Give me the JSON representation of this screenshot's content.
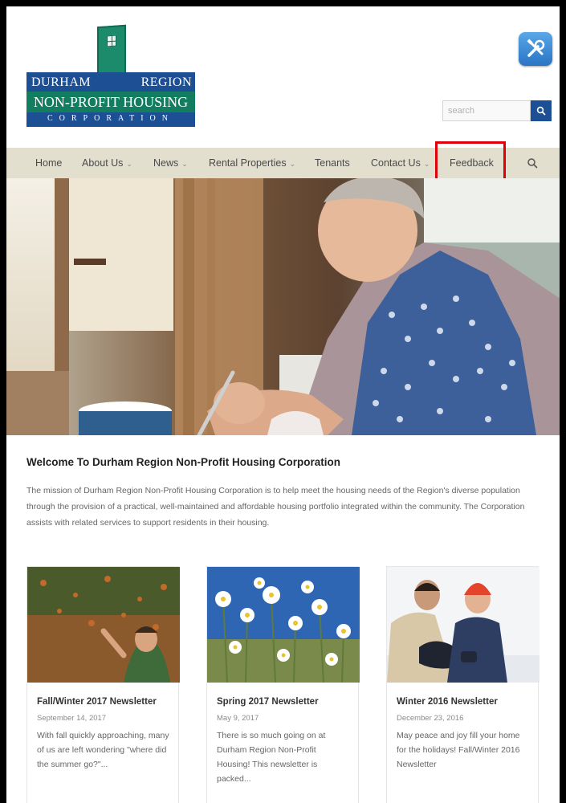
{
  "logo": {
    "word_left": "DURHAM",
    "word_right": "REGION",
    "word_mid": "NON-PROFIT HOUSING",
    "word_corp": "CORPORATION"
  },
  "header": {
    "tools_icon": "tools-icon",
    "search_placeholder": "search",
    "search_button_icon": "search-icon"
  },
  "nav": {
    "items": [
      {
        "label": "Home",
        "has_dropdown": false
      },
      {
        "label": "About Us",
        "has_dropdown": true
      },
      {
        "label": "News",
        "has_dropdown": true
      },
      {
        "label": "Rental Properties",
        "has_dropdown": true
      },
      {
        "label": "Tenants",
        "has_dropdown": false
      },
      {
        "label": "Contact Us",
        "has_dropdown": true
      },
      {
        "label": "Feedback",
        "has_dropdown": false
      }
    ],
    "chevron": "⌄",
    "highlight_color": "#e0000b"
  },
  "welcome": {
    "title": "Welcome To Durham Region Non-Profit Housing Corporation",
    "text": "The mission of Durham Region Non-Profit Housing Corporation is to help meet the housing needs of the Region's diverse population through the provision of a practical, well-maintained and affordable housing portfolio integrated within the community.  The Corporation assists with related services to support residents in their housing."
  },
  "cards": [
    {
      "title": "Fall/Winter 2017 Newsletter",
      "date": "September 14, 2017",
      "excerpt": "With fall quickly approaching, many of us are left wondering \"where did the summer go?\"..."
    },
    {
      "title": "Spring 2017 Newsletter",
      "date": "May 9, 2017",
      "excerpt": "There is so much going on at Durham Region Non-Profit Housing! This newsletter is packed..."
    },
    {
      "title": "Winter 2016 Newsletter",
      "date": "December 23, 2016",
      "excerpt": "May peace and joy fill your home for the holidays! Fall/Winter 2016 Newsletter"
    }
  ],
  "colors": {
    "brand_blue": "#1d4f94",
    "brand_green": "#137d60",
    "nav_bg": "#e2dfce"
  }
}
